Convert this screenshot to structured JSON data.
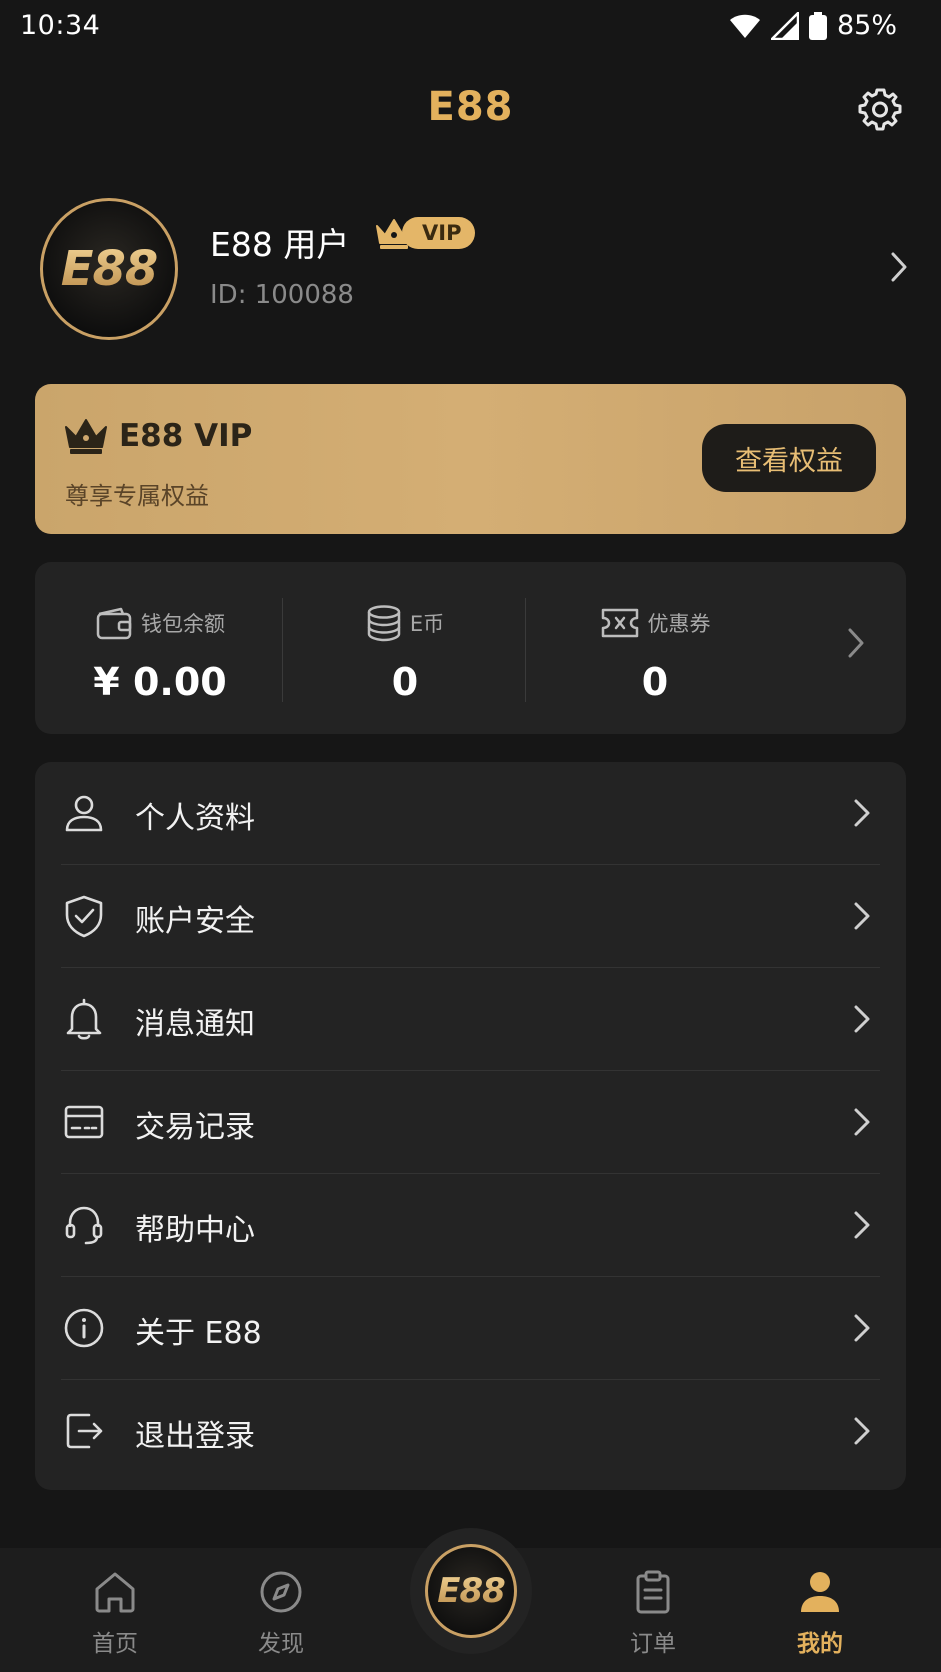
{
  "status_bar": {
    "time": "10:34",
    "battery": "85%"
  },
  "header": {
    "title": "E88"
  },
  "profile": {
    "avatar_logo": "E88",
    "name": "E88 用户",
    "badge": "VIP",
    "id_text": "ID: 100088"
  },
  "vip_card": {
    "title": "E88 VIP",
    "subtitle": "尊享专属权益",
    "button": "查看权益"
  },
  "stats": {
    "wallet": {
      "label": "钱包余额",
      "value": "¥ 0.00"
    },
    "coins": {
      "label": "E币",
      "value": "0"
    },
    "coupons": {
      "label": "优惠券",
      "value": "0"
    }
  },
  "menu": {
    "items": [
      {
        "label": "个人资料",
        "icon": "user-icon"
      },
      {
        "label": "账户安全",
        "icon": "shield-check-icon"
      },
      {
        "label": "消息通知",
        "icon": "bell-icon"
      },
      {
        "label": "交易记录",
        "icon": "card-icon"
      },
      {
        "label": "帮助中心",
        "icon": "headset-icon"
      },
      {
        "label": "关于 E88",
        "icon": "info-icon"
      },
      {
        "label": "退出登录",
        "icon": "logout-icon"
      }
    ]
  },
  "tab_bar": {
    "home": "首页",
    "discover": "发现",
    "center_logo": "E88",
    "orders": "订单",
    "mine": "我的"
  },
  "colors": {
    "accent": "#e3b15d",
    "background": "#161616",
    "card": "#232323"
  }
}
